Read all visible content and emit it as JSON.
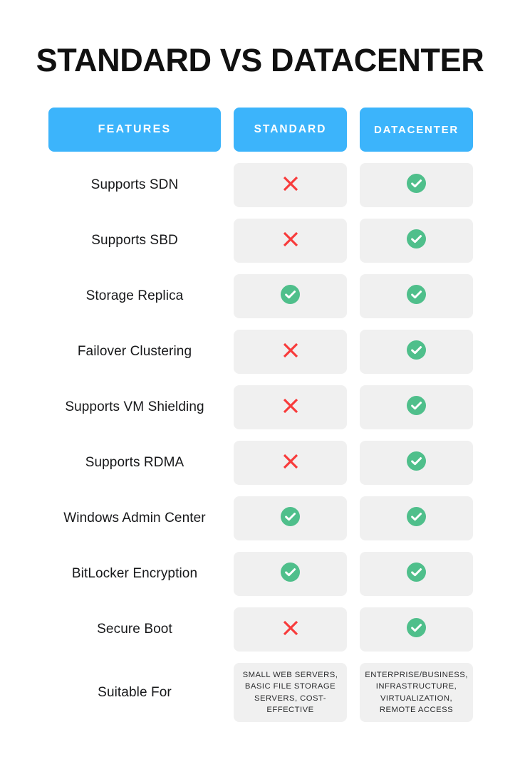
{
  "page": {
    "title": "STANDARD VS DATACENTER",
    "background": "#ffffff"
  },
  "colors": {
    "header_blue": "#3cb4fb",
    "cell_gray": "#f0f0f0",
    "check_green": "#4fbf8b",
    "cross_red": "#f83b3b",
    "title_black": "#111111"
  },
  "table": {
    "headers": {
      "features": "FEATURES",
      "standard": "STANDARD",
      "datacenter": "DATACENTER"
    },
    "rows": [
      {
        "feature": "Supports SDN",
        "standard": "cross",
        "datacenter": "check"
      },
      {
        "feature": "Supports SBD",
        "standard": "cross",
        "datacenter": "check"
      },
      {
        "feature": "Storage Replica",
        "standard": "check",
        "datacenter": "check"
      },
      {
        "feature": "Failover Clustering",
        "standard": "cross",
        "datacenter": "check"
      },
      {
        "feature": "Supports VM Shielding",
        "standard": "cross",
        "datacenter": "check"
      },
      {
        "feature": "Supports RDMA",
        "standard": "cross",
        "datacenter": "check"
      },
      {
        "feature": "Windows Admin Center",
        "standard": "check",
        "datacenter": "check"
      },
      {
        "feature": "BitLocker Encryption",
        "standard": "check",
        "datacenter": "check"
      },
      {
        "feature": "Secure Boot",
        "standard": "cross",
        "datacenter": "check"
      }
    ],
    "last_row": {
      "feature": "Suitable For",
      "standard": "SMALL WEB SERVERS, BASIC FILE STORAGE SERVERS, COST-EFFECTIVE",
      "datacenter": "ENTERPRISE/BUSINESS, INFRASTRUCTURE, VIRTUALIZATION, REMOTE ACCESS"
    }
  },
  "icons": {
    "check": "check-circle-icon",
    "cross": "cross-icon"
  }
}
